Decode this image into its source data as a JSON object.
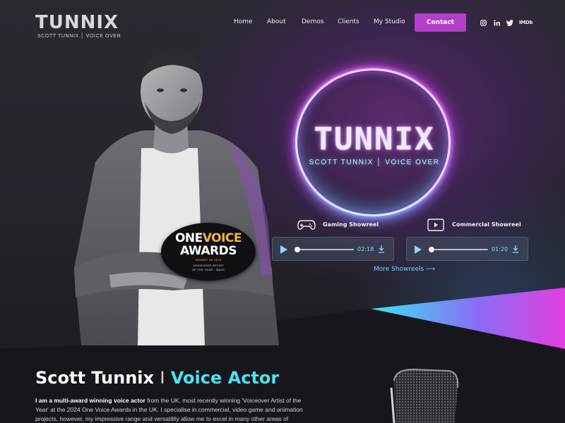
{
  "header": {
    "logo_main": "TUNNIX",
    "logo_sub": "SCOTT TUNNIX │ VOICE OVER",
    "nav": [
      "Home",
      "About",
      "Demos",
      "Clients",
      "My Studio"
    ],
    "contact_label": "Contact",
    "social": [
      "instagram-icon",
      "linkedin-icon",
      "twitter-icon",
      "imdb-icon"
    ],
    "imdb_label": "IMDb"
  },
  "hero": {
    "neon_title": "TUNNIX",
    "neon_sub": "SCOTT TUNNIX │ VOICE OVER",
    "showreels": [
      {
        "label": "Gaming Showreel",
        "icon": "gamepad-icon",
        "time": "02:18",
        "progress": 0.0
      },
      {
        "label": "Commercial Showreel",
        "icon": "video-play-icon",
        "time": "01:20",
        "progress": 0.0
      }
    ],
    "more_showreels": "More Showreels ⟶",
    "award": {
      "one": "ONE",
      "voice": "VOICE",
      "awards": "AWARDS",
      "line1": "WINNER UK 2024",
      "line2": "VOICEOVER ARTIST",
      "line3": "OF THE YEAR - MALE"
    }
  },
  "intro": {
    "name": "Scott Tunnix",
    "separator": "I",
    "role": "Voice Actor",
    "bio_bold": "I am a multi-award winning voice actor",
    "bio_rest": " from the UK, most recently winning 'Voiceover Artist of the Year' at the 2024 One Voice Awards in the UK. I specialise in commercial, video game and animation projects, however, my impressive range and versatility allow me to excel in many other areas of voiceover from e-"
  },
  "colors": {
    "accent_purple": "#b13fc9",
    "accent_cyan": "#4ce2f0",
    "background": "#17161c"
  }
}
